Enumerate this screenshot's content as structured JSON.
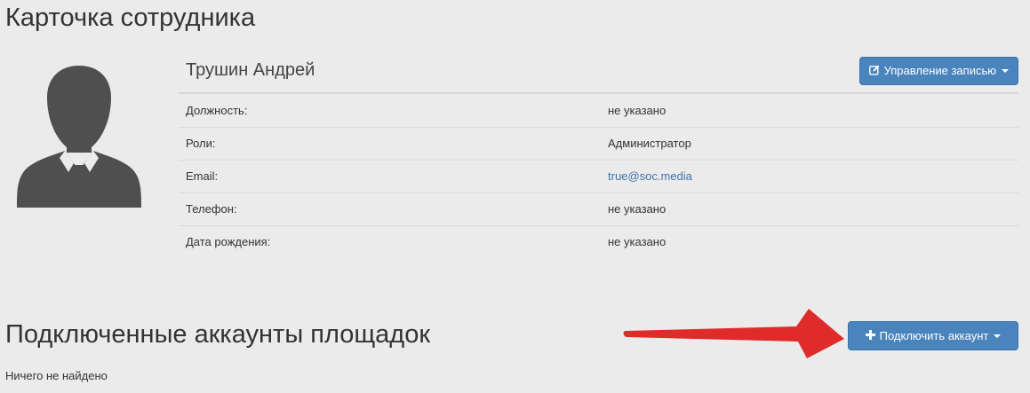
{
  "page": {
    "title": "Карточка сотрудника"
  },
  "employee": {
    "name": "Трушин Андрей",
    "manage_button_label": "Управление записью",
    "fields": [
      {
        "label": "Должность:",
        "value": "не указано"
      },
      {
        "label": "Роли:",
        "value": "Администратор"
      },
      {
        "label": "Email:",
        "value": "true@soc.media"
      },
      {
        "label": "Телефон:",
        "value": "не указано"
      },
      {
        "label": "Дата рождения:",
        "value": "не указано"
      }
    ]
  },
  "accounts": {
    "title": "Подключенные аккаунты площадок",
    "connect_button_label": "Подключить аккаунт",
    "empty_text": "Ничего не найдено"
  },
  "icons": {
    "manage": "edit-square-icon",
    "connect": "plus-icon",
    "avatar": "user-silhouette-icon",
    "annotation": "red-arrow"
  },
  "colors": {
    "background": "#ebebeb",
    "primary_button": "#4a84bd",
    "link": "#3b73ad",
    "arrow": "#e02b2b",
    "avatar": "#4f4f4f"
  }
}
